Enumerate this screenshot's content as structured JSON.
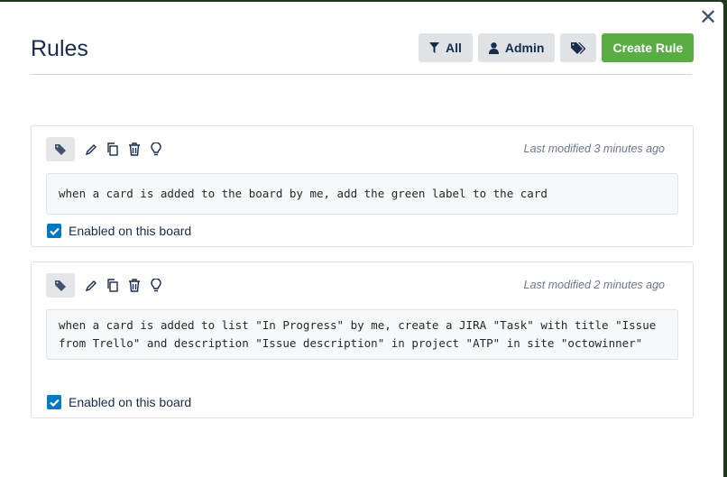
{
  "title": "Rules",
  "toolbar": {
    "all_label": "All",
    "admin_label": "Admin",
    "create_label": "Create Rule"
  },
  "rules": [
    {
      "modified": "Last modified 3 minutes ago",
      "text": "when a card is added to the board by me, add the green label to the card",
      "enabled_label": "Enabled on this board",
      "enabled": true
    },
    {
      "modified": "Last modified 2 minutes ago",
      "text": "when a card is added to list \"In Progress\" by me, create a JIRA \"Task\" with title \"Issue from Trello\" and description \"Issue description\" in project \"ATP\" in site \"octowinner\"",
      "enabled_label": "Enabled on this board",
      "enabled": true
    }
  ],
  "colors": {
    "accent": "#5aac44",
    "checkbox": "#0079bf"
  }
}
